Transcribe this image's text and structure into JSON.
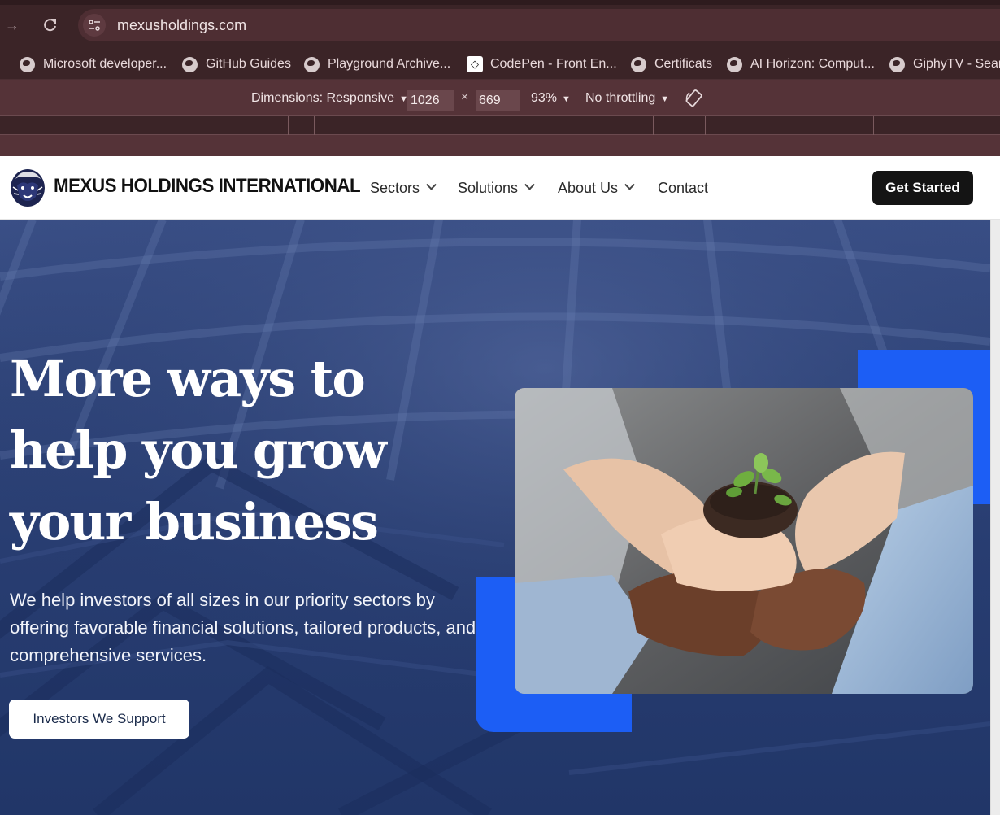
{
  "browser": {
    "url": "mexusholdings.com",
    "bookmarks": [
      {
        "label": "Microsoft developer...",
        "icon": "globe-icon"
      },
      {
        "label": "GitHub Guides",
        "icon": "globe-icon"
      },
      {
        "label": "Playground Archive...",
        "icon": "globe-icon"
      },
      {
        "label": "CodePen - Front En...",
        "icon": "codepen-icon"
      },
      {
        "label": "Certificats",
        "icon": "globe-icon"
      },
      {
        "label": "AI Horizon: Comput...",
        "icon": "globe-icon"
      },
      {
        "label": "GiphyTV - Searc",
        "icon": "globe-icon"
      }
    ]
  },
  "devtools": {
    "dimensions_label": "Dimensions: Responsive",
    "width": "1026",
    "times": "×",
    "height": "669",
    "zoom": "93%",
    "throttling": "No throttling"
  },
  "site": {
    "brand": "MEXUS HOLDINGS INTERNATIONAL",
    "nav": {
      "sectors": "Sectors",
      "solutions": "Solutions",
      "about": "About Us",
      "contact": "Contact"
    },
    "cta": "Get Started",
    "hero": {
      "title": "More ways to help you grow your business",
      "text": "We help investors of all sizes in our priority sectors by offering favorable financial solutions, tailored products, and comprehensive services.",
      "button": "Investors We Support"
    },
    "colors": {
      "accent_blue": "#1c5ef5",
      "hero_navy": "#2f4479",
      "cta_black": "#141414"
    }
  }
}
